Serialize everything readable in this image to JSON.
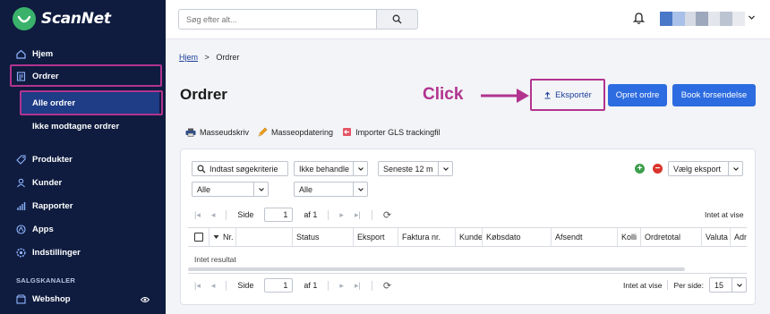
{
  "app": {
    "name": "ScanNet"
  },
  "sidebar": {
    "items": [
      {
        "label": "Hjem",
        "icon": "home-icon"
      },
      {
        "label": "Ordrer",
        "icon": "orders-icon"
      },
      {
        "label": "Alle ordrer"
      },
      {
        "label": "Ikke modtagne ordrer"
      },
      {
        "label": "Produkter",
        "icon": "tag-icon"
      },
      {
        "label": "Kunder",
        "icon": "user-icon"
      },
      {
        "label": "Rapporter",
        "icon": "bar-chart-icon"
      },
      {
        "label": "Apps",
        "icon": "apps-icon"
      },
      {
        "label": "Indstillinger",
        "icon": "gear-icon"
      }
    ],
    "section_title": "SALGSKANALER",
    "channel": {
      "label": "Webshop",
      "icon": "store-icon"
    }
  },
  "topbar": {
    "search_placeholder": "Søg efter alt..."
  },
  "breadcrumb": {
    "home": "Hjem",
    "separator": ">",
    "current": "Ordrer"
  },
  "page": {
    "title": "Ordrer"
  },
  "annotation": {
    "click_label": "Click"
  },
  "actions": {
    "export_label": "Eksportér",
    "create_order_label": "Opret ordre",
    "book_shipment_label": "Book forsendelse"
  },
  "toolbar": {
    "mass_print": "Masseudskriv",
    "mass_update": "Masseopdatering",
    "import_gls": "Importer GLS trackingfil"
  },
  "filters": {
    "search_placeholder": "Indtast søgekriterie",
    "status_select": "Ikke behandle",
    "period_select": "Seneste 12 m",
    "filter1": "Alle",
    "filter2": "Alle",
    "export_select": "Vælg eksport"
  },
  "pager_top": {
    "page_label": "Side",
    "page_value": "1",
    "of_label": "af 1",
    "info": "Intet at vise"
  },
  "pager_bottom": {
    "page_label": "Side",
    "page_value": "1",
    "of_label": "af 1",
    "info": "Intet at vise",
    "per_page_label": "Per side:",
    "per_page_value": "15"
  },
  "grid": {
    "columns": [
      "Nr.",
      "",
      "Status",
      "Eksport",
      "Faktura nr.",
      "Kunde",
      "Købsdato",
      "Afsendt",
      "Kolli",
      "Ordretotal",
      "Valuta",
      "Adn"
    ],
    "empty_text": "Intet resultat"
  },
  "colors": {
    "sidebar_bg": "#0f1c3f",
    "active_item": "#1f3c86",
    "primary": "#2d6ce0",
    "highlight": "#b2348f"
  }
}
